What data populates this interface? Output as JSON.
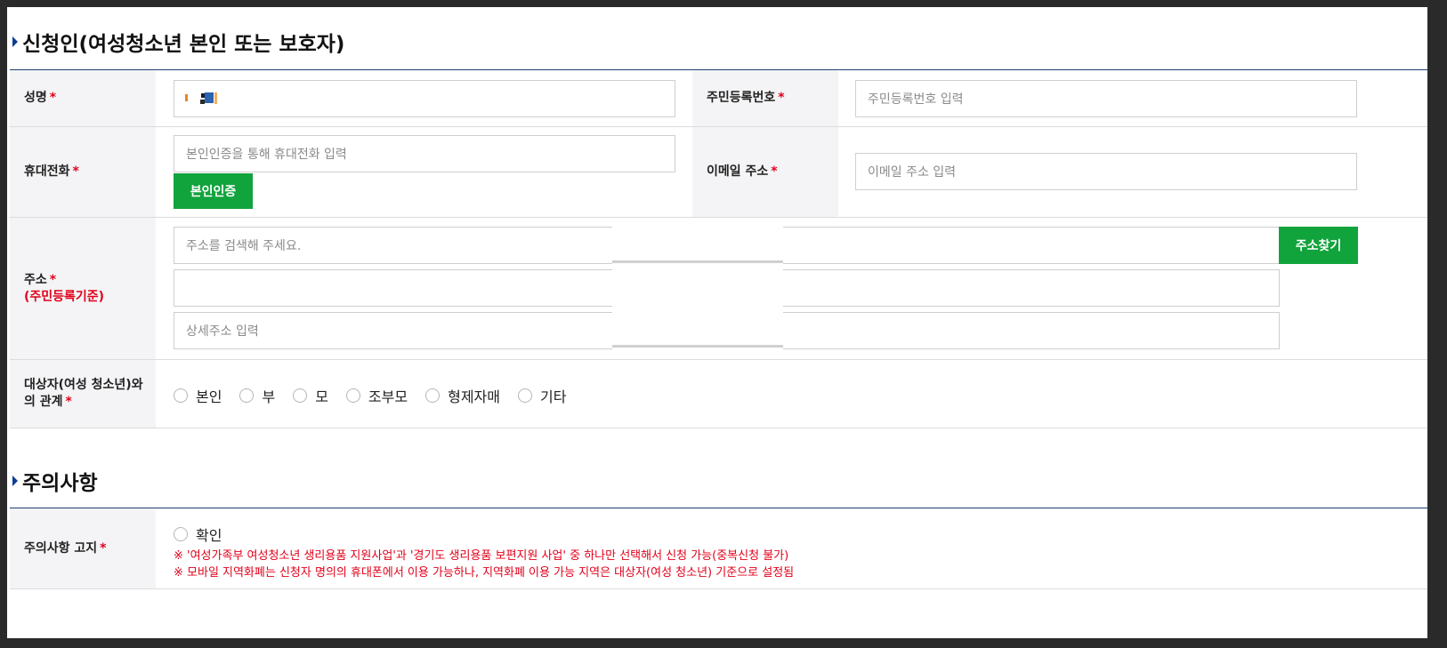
{
  "applicant_section": {
    "title": "신청인(여성청소년 본인 또는 보호자)",
    "name": {
      "label": "성명",
      "required": "*"
    },
    "resident_number": {
      "label": "주민등록번호",
      "required": "*",
      "placeholder": "주민등록번호 입력"
    },
    "mobile": {
      "label": "휴대전화",
      "required": "*",
      "placeholder": "본인인증을 통해 휴대전화 입력",
      "verify_button": "본인인증"
    },
    "email": {
      "label": "이메일 주소",
      "required": "*",
      "placeholder": "이메일 주소 입력"
    },
    "address": {
      "label": "주소",
      "required": "*",
      "sub_label": "(주민등록기준)",
      "search_placeholder": "주소를 검색해 주세요.",
      "search_button": "주소찾기",
      "detail_placeholder": "상세주소 입력"
    },
    "relation": {
      "label_line1": "대상자(여성 청소년)와",
      "label_line2": "의 관계",
      "required": "*",
      "options": [
        "본인",
        "부",
        "모",
        "조부모",
        "형제자매",
        "기타"
      ]
    }
  },
  "notice_section": {
    "title": "주의사항",
    "notice": {
      "label": "주의사항 고지",
      "required": "*",
      "confirm_option": "확인",
      "notes": [
        "※ '여성가족부 여성청소년 생리용품 지원사업'과 '경기도 생리용품 보편지원 사업' 중 하나만 선택해서 신청 가능(중복신청 불가)",
        "※ 모바일 지역화폐는 신청자 명의의 휴대폰에서 이용 가능하나, 지역화폐 이용 가능 지역은 대상자(여성 청소년) 기준으로 설정됨"
      ]
    }
  },
  "colors": {
    "accent_green": "#11a33c",
    "required_red": "#e2001a",
    "title_rule": "#1f3f73",
    "label_bg": "#f4f4f6"
  }
}
